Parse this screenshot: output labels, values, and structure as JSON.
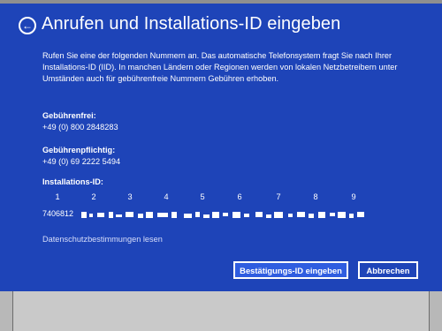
{
  "dialog": {
    "title": "Anrufen und Installations-ID eingeben",
    "back_icon": "arrow-left-circle-icon",
    "description": "Rufen Sie eine der folgenden Nummern an. Das automatische Telefonsystem fragt Sie nach Ihrer Installations-ID (IID). In manchen Ländern oder Regionen werden von lokalen Netzbetreibern unter Umständen auch für gebührenfreie Nummern Gebühren erhoben.",
    "tollfree_label": "Gebührenfrei:",
    "tollfree_number": "+49 (0) 800 2848283",
    "toll_label": "Gebührenpflichtig:",
    "toll_number": "+49 (0) 69 2222 5494",
    "iid_label": "Installations-ID:",
    "iid_columns": [
      "1",
      "2",
      "3",
      "4",
      "5",
      "6",
      "7",
      "8",
      "9"
    ],
    "iid_first_block": "7406812",
    "privacy_link": "Datenschutzbestimmungen lesen",
    "confirm_button": "Bestätigungs-ID eingeben",
    "cancel_button": "Abbrechen"
  },
  "colors": {
    "dialog_bg": "#1e44b8",
    "primary_button_bg": "#2f5de0",
    "text": "#ffffff"
  }
}
